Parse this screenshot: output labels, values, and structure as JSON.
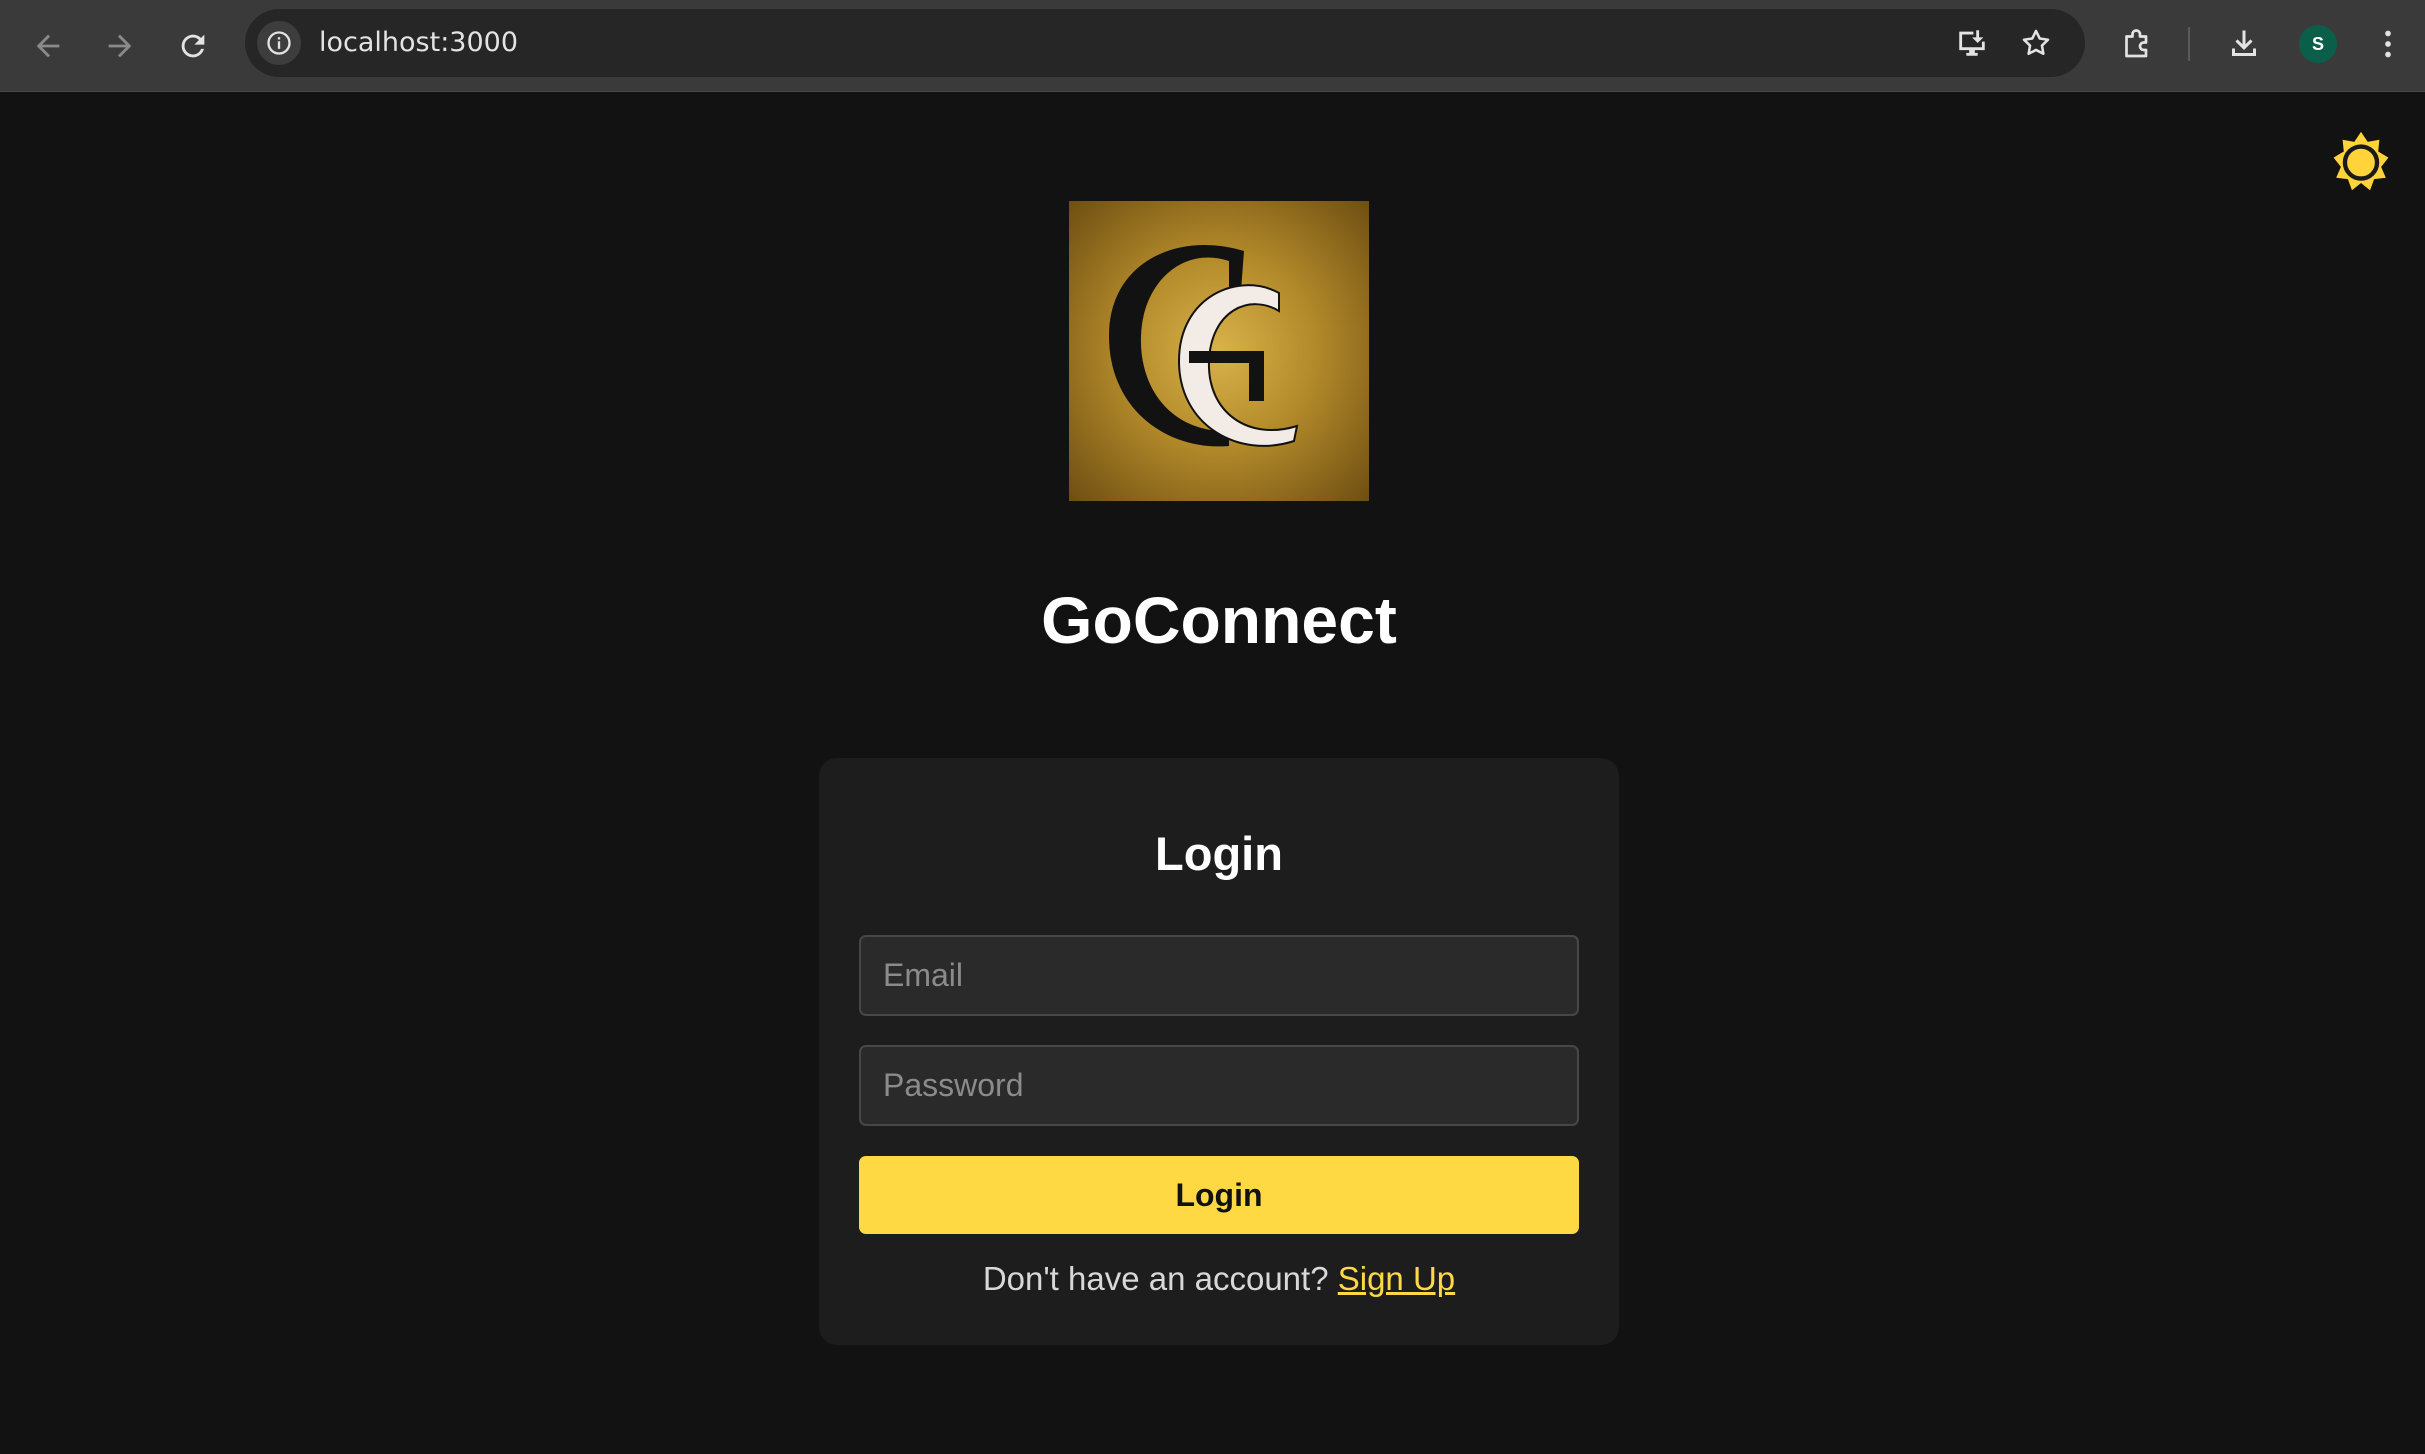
{
  "browser": {
    "url": "localhost:3000",
    "avatar_letter": "S",
    "icons": [
      "back-icon",
      "forward-icon",
      "reload-icon",
      "site-info-icon",
      "install-app-icon",
      "bookmark-star-icon",
      "extensions-icon",
      "downloads-icon",
      "profile-avatar",
      "menu-dots-icon"
    ]
  },
  "page": {
    "theme_toggle_icon": "sun-icon",
    "app_title": "GoConnect",
    "logo_letters": "GC"
  },
  "login_form": {
    "title": "Login",
    "email_placeholder": "Email",
    "email_value": "",
    "password_placeholder": "Password",
    "password_value": "",
    "submit_label": "Login",
    "signup_prompt": "Don't have an account? ",
    "signup_link": "Sign Up"
  },
  "colors": {
    "background": "#121212",
    "card": "#1d1d1d",
    "accent": "#ffd943",
    "input_bg": "#2a2a2a"
  }
}
